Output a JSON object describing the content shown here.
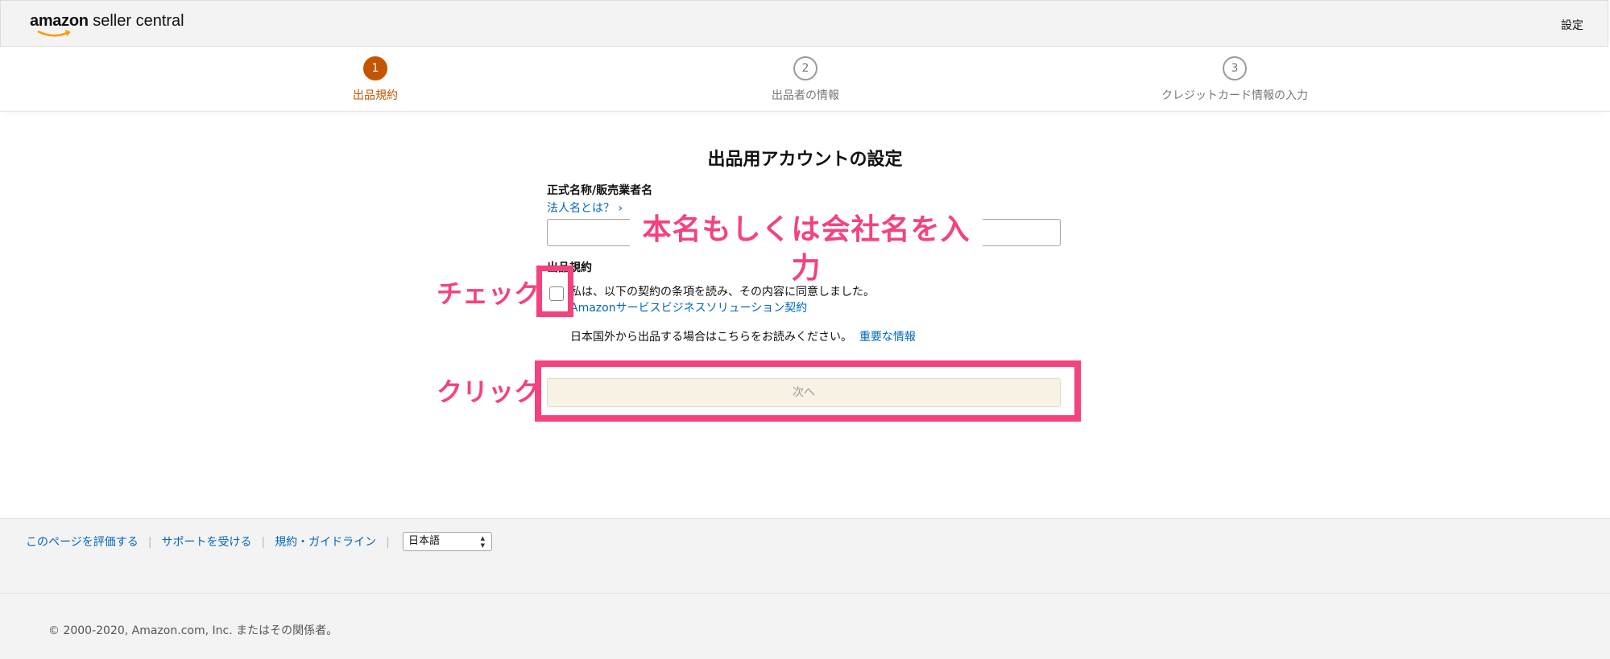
{
  "header": {
    "logo_brand": "amazon",
    "logo_rest": " seller central",
    "settings_label": "設定"
  },
  "stepper": {
    "steps": [
      {
        "number": "1",
        "label": "出品規約",
        "active": true
      },
      {
        "number": "2",
        "label": "出品者の情報",
        "active": false
      },
      {
        "number": "3",
        "label": "クレジットカード情報の入力",
        "active": false
      }
    ]
  },
  "form": {
    "title": "出品用アカウントの設定",
    "name_label": "正式名称/販売業者名",
    "name_help_link": "法人名とは？ ›",
    "name_value": "",
    "terms_label": "出品規約",
    "agree_text": "私は、以下の契約の条項を読み、その内容に同意しました。",
    "contract_link": "Amazonサービスビジネスソリューション契約",
    "outside_text": "日本国外から出品する場合はこちらをお読みください。",
    "important_link": "重要な情報",
    "next_button": "次へ"
  },
  "annotations": {
    "name_hint": "本名もしくは会社名を入力",
    "check_hint": "チェック",
    "click_hint": "クリック",
    "color": "#f5427c"
  },
  "footer": {
    "links": [
      "このページを評価する",
      "サポートを受ける",
      "規約・ガイドライン"
    ],
    "language": "日本語",
    "copyright": "© 2000-2020, Amazon.com, Inc. またはその関係者。"
  },
  "colors": {
    "accent": "#c45500",
    "link": "#0066c0"
  }
}
